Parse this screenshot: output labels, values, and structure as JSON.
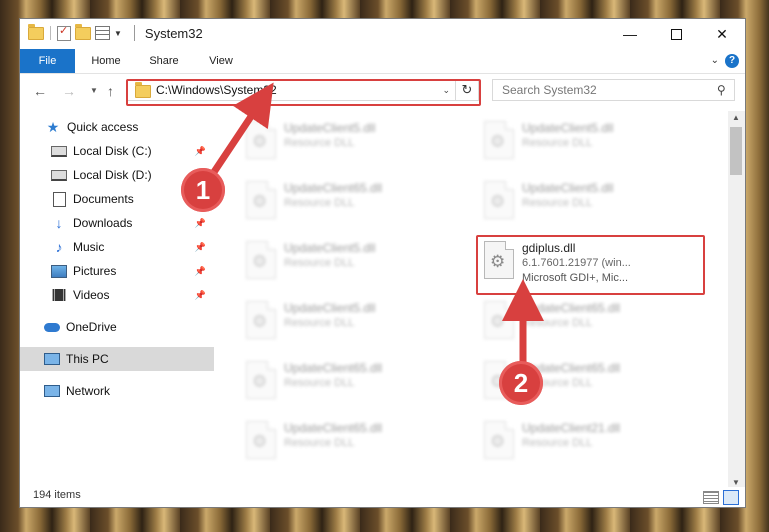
{
  "window": {
    "title": "System32",
    "tabs": [
      "File",
      "Home",
      "Share",
      "View"
    ],
    "help_label": "?"
  },
  "address": {
    "path": "C:\\Windows\\System32",
    "search_placeholder": "Search System32"
  },
  "nav": {
    "items": [
      {
        "label": "Quick access",
        "icon": "star-icon"
      },
      {
        "label": "Local Disk (C:)",
        "icon": "disk-icon",
        "pinned": true
      },
      {
        "label": "Local Disk (D:)",
        "icon": "disk-icon",
        "pinned": false
      },
      {
        "label": "Documents",
        "icon": "documents-icon",
        "pinned": true
      },
      {
        "label": "Downloads",
        "icon": "download-icon",
        "pinned": true
      },
      {
        "label": "Music",
        "icon": "music-icon",
        "pinned": true
      },
      {
        "label": "Pictures",
        "icon": "pictures-icon",
        "pinned": true
      },
      {
        "label": "Videos",
        "icon": "videos-icon",
        "pinned": true
      },
      {
        "label": "OneDrive",
        "icon": "onedrive-icon"
      },
      {
        "label": "This PC",
        "icon": "computer-icon",
        "selected": true
      },
      {
        "label": "Network",
        "icon": "network-icon"
      }
    ]
  },
  "files": {
    "left": [
      {
        "name": "UpdateClient5.dll",
        "type": "Resource DLL"
      },
      {
        "name": "UpdateClient65.dll",
        "type": "Resource DLL"
      },
      {
        "name": "UpdateClient5.dll",
        "type": "Resource DLL"
      },
      {
        "name": "UpdateClient5.dll",
        "type": "Resource DLL"
      },
      {
        "name": "UpdateClient65.dll",
        "type": "Resource DLL"
      },
      {
        "name": "UpdateClient65.dll",
        "type": "Resource DLL"
      }
    ],
    "right": [
      {
        "name": "UpdateClient5.dll",
        "type": "Resource DLL"
      },
      {
        "name": "UpdateClient5.dll",
        "type": "Resource DLL"
      },
      {
        "name": "UpdateClient65.dll",
        "type": "Resource DLL"
      },
      {
        "name": "UpdateClient65.dll",
        "type": "Resource DLL"
      },
      {
        "name": "UpdateClient21.dll",
        "type": "Resource DLL"
      }
    ],
    "highlighted": {
      "name": "gdiplus.dll",
      "version": "6.1.7601.21977 (win...",
      "description": "Microsoft GDI+, Mic..."
    }
  },
  "status": {
    "item_count": "194 items"
  },
  "annotations": {
    "step1": "1",
    "step2": "2",
    "color": "#d8403f"
  }
}
